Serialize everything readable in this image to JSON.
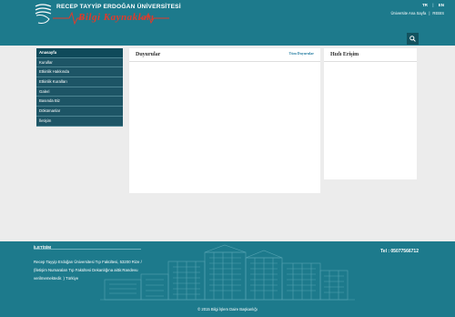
{
  "header": {
    "university_name": "RECEP TAYYİP ERDOĞAN ÜNİVERSİTESİ",
    "unit_name": "Bilgi Kaynakları",
    "languages": [
      "TR",
      "EN"
    ],
    "top_links": [
      "Üniversite Ana Sayfa",
      "REBIS"
    ],
    "search_icon": "search-icon"
  },
  "sidebar": {
    "items": [
      {
        "label": "Anasayfa"
      },
      {
        "label": "Kurullar"
      },
      {
        "label": "Etkinlik Hakkında"
      },
      {
        "label": "Etkinlik Kuralları"
      },
      {
        "label": "Galeri"
      },
      {
        "label": "Basında Biz"
      },
      {
        "label": "Dökümanlar"
      },
      {
        "label": "İletişim"
      }
    ]
  },
  "announcements": {
    "title": "Duyurular",
    "all_link": "Tüm Duyurular"
  },
  "quick_access": {
    "title": "Hızlı Erişim"
  },
  "footer": {
    "title": "İLETİŞİM",
    "address_line_1": "Recep Tayyip Erdoğan Üniversitesi Tıp Fakültesi, 53200 Rize /",
    "address_line_2": "(İletişim Numaraları Tıp Fakültesi Dekanlığına aittir.Randevu",
    "address_line_3": "verilmemektedir. ) Türkiye",
    "phone": "Tel : 05077566712",
    "copyright": "© 2015 Bilgi İşlem Daire Başkanlığı"
  },
  "colors": {
    "header_bg": "#1d7a8c",
    "sidebar_bg": "#1d5566",
    "accent_red": "#e23a2a"
  }
}
